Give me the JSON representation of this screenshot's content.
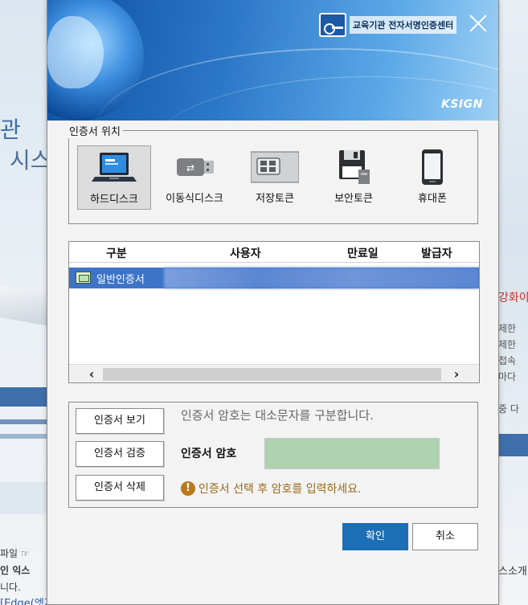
{
  "background": {
    "left": {
      "heading1": "관",
      "heading2": "시스",
      "line1": "파일 ☞ ",
      "line2": "인 익스",
      "line3": "니다.",
      "link": "[Edge(엣지)용 설치방법 다운로드]"
    },
    "right": {
      "red_text": "강화이",
      "lines": [
        "제한",
        "제한",
        "접속",
        "마다",
        "중 다"
      ],
      "bottom": "스소개"
    }
  },
  "dialog": {
    "brand_text": "교육기관 전자서명인증센터",
    "vendor_logo": "KSIGN",
    "storage_group": {
      "legend": "인증서 위치",
      "options": [
        {
          "label": "하드디스크",
          "icon": "laptop-icon",
          "selected": true
        },
        {
          "label": "이동식디스크",
          "icon": "usb-drive-icon",
          "selected": false
        },
        {
          "label": "저장토큰",
          "icon": "smartcard-icon",
          "selected": false
        },
        {
          "label": "보안토큰",
          "icon": "floppy-disk-icon",
          "selected": false
        },
        {
          "label": "휴대폰",
          "icon": "mobile-phone-icon",
          "selected": false
        }
      ]
    },
    "cert_table": {
      "columns": [
        "구분",
        "사용자",
        "만료일",
        "발급자"
      ],
      "rows": [
        {
          "type": "일반인증서",
          "user": "",
          "expiry": "",
          "issuer": ""
        }
      ]
    },
    "actions": {
      "view": "인증서 보기",
      "verify": "인증서 검증",
      "delete": "인증서 삭제"
    },
    "password": {
      "note": "인증서 암호는 대소문자를 구분합니다.",
      "label": "인증서 암호",
      "value": "",
      "warning": "인증서 선택 후 암호를 입력하세요."
    },
    "buttons": {
      "ok": "확인",
      "cancel": "취소"
    },
    "colors": {
      "accent": "#1c6eb5",
      "selected_row": "#3d74c8",
      "password_field": "#afd3b0",
      "warning": "#9a6a1a"
    }
  }
}
